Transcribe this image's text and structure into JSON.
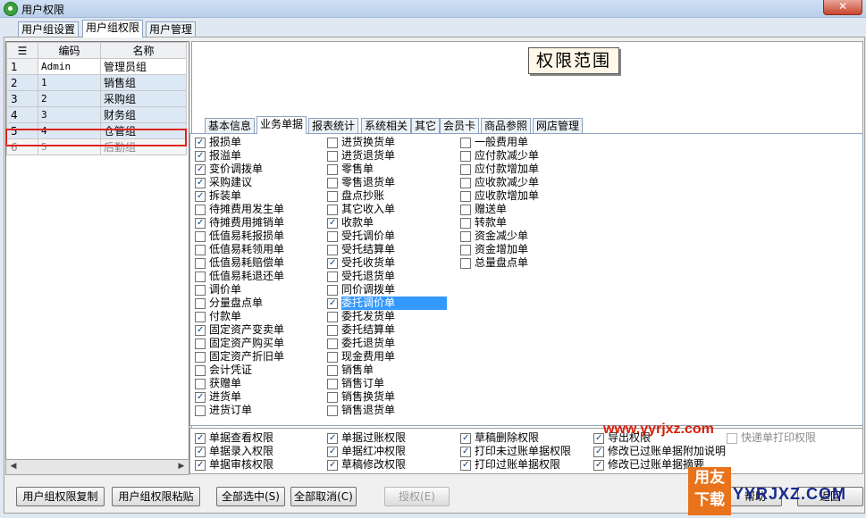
{
  "window": {
    "title": "用户权限",
    "close": "✕"
  },
  "main_tabs": [
    "用户组设置",
    "用户组权限",
    "用户管理"
  ],
  "grid": {
    "headers": [
      "编码",
      "名称"
    ],
    "rows": [
      [
        "1",
        "Admin",
        "管理员组"
      ],
      [
        "2",
        "1",
        "销售组"
      ],
      [
        "3",
        "2",
        "采购组"
      ],
      [
        "4",
        "3",
        "财务组"
      ],
      [
        "5",
        "4",
        "仓管组"
      ],
      [
        "6",
        "5",
        "后勤组"
      ]
    ]
  },
  "scope_label": "权限范围",
  "sub_tabs": [
    "基本信息",
    "业务单据",
    "报表统计",
    "系统相关",
    "其它",
    "会员卡",
    "商品参照",
    "网店管理"
  ],
  "col1": [
    [
      "报损单",
      true
    ],
    [
      "报溢单",
      true
    ],
    [
      "变价调拨单",
      true
    ],
    [
      "采购建议",
      true
    ],
    [
      "拆装单",
      true
    ],
    [
      "待摊费用发生单",
      false
    ],
    [
      "待摊费用摊销单",
      true
    ],
    [
      "低值易耗报损单",
      false
    ],
    [
      "低值易耗领用单",
      false
    ],
    [
      "低值易耗赔偿单",
      false
    ],
    [
      "低值易耗退还单",
      false
    ],
    [
      "调价单",
      false
    ],
    [
      "分量盘点单",
      false
    ],
    [
      "付款单",
      false
    ],
    [
      "固定资产变卖单",
      true
    ],
    [
      "固定资产购买单",
      false
    ],
    [
      "固定资产折旧单",
      false
    ],
    [
      "会计凭证",
      false
    ],
    [
      "获赠单",
      false
    ],
    [
      "进货单",
      true
    ],
    [
      "进货订单",
      false
    ]
  ],
  "col2": [
    [
      "进货换货单",
      false
    ],
    [
      "进货退货单",
      false
    ],
    [
      "零售单",
      false
    ],
    [
      "零售退货单",
      false
    ],
    [
      "盘点抄账",
      false
    ],
    [
      "其它收入单",
      false
    ],
    [
      "收款单",
      true
    ],
    [
      "受托调价单",
      false
    ],
    [
      "受托结算单",
      false
    ],
    [
      "受托收货单",
      true
    ],
    [
      "受托退货单",
      false
    ],
    [
      "同价调拨单",
      false
    ],
    [
      "委托调价单",
      true
    ],
    [
      "委托发货单",
      false
    ],
    [
      "委托结算单",
      false
    ],
    [
      "委托退货单",
      false
    ],
    [
      "现金费用单",
      false
    ],
    [
      "销售单",
      false
    ],
    [
      "销售订单",
      false
    ],
    [
      "销售换货单",
      false
    ],
    [
      "销售退货单",
      false
    ]
  ],
  "col3": [
    [
      "一般费用单",
      false
    ],
    [
      "应付款减少单",
      false
    ],
    [
      "应付款增加单",
      false
    ],
    [
      "应收款减少单",
      false
    ],
    [
      "应收款增加单",
      false
    ],
    [
      "赠送单",
      false
    ],
    [
      "转款单",
      false
    ],
    [
      "资金减少单",
      false
    ],
    [
      "资金增加单",
      false
    ],
    [
      "总量盘点单",
      false
    ]
  ],
  "bottom_checks": [
    [
      [
        "单据查看权限",
        true
      ],
      [
        "单据过账权限",
        true
      ],
      [
        "草稿删除权限",
        true
      ],
      [
        "导出权限",
        true
      ],
      [
        "快递单打印权限",
        false
      ]
    ],
    [
      [
        "单据录入权限",
        true
      ],
      [
        "单据红冲权限",
        true
      ],
      [
        "打印未过账单据权限",
        true
      ],
      [
        "修改已过账单据附加说明",
        true
      ]
    ],
    [
      [
        "单据审核权限",
        true
      ],
      [
        "草稿修改权限",
        true
      ],
      [
        "打印过账单据权限",
        true
      ],
      [
        "修改已过账单据摘要",
        true
      ]
    ]
  ],
  "buttons": {
    "copy": "用户组权限复制",
    "paste": "用户组权限粘贴",
    "select_all": "全部选中(S)",
    "cancel_all": "全部取消(C)",
    "authorize": "授权(E)",
    "help": "帮助",
    "back": "返回"
  },
  "overlay": {
    "url": "www.yyrjxz.com",
    "logo_top": "用友",
    "logo_bottom": "下载",
    "watermark": "YYRJXZ.COM"
  },
  "colors": {
    "highlight": "#e0201c",
    "selection": "#3399ff",
    "title_bar": "#c4d9f0"
  }
}
